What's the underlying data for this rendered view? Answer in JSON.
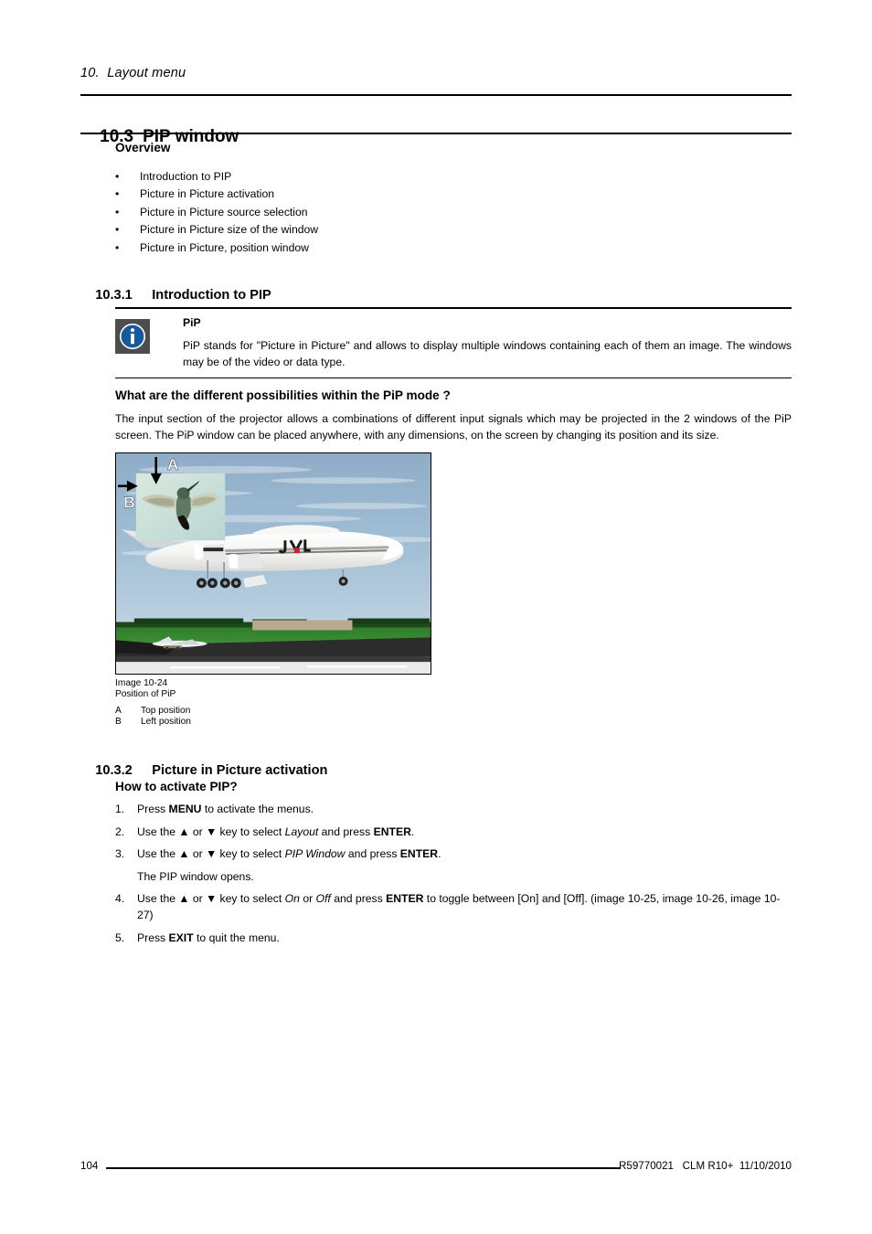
{
  "page": {
    "running_head": "10.  Layout menu",
    "chapter_number": "10.3",
    "chapter_title": "PIP window"
  },
  "overview": {
    "heading": "Overview",
    "bullet_char": "•",
    "items": [
      "Introduction to PIP",
      "Picture in Picture activation",
      "Picture in Picture source selection",
      "Picture in Picture size of the window",
      "Picture in Picture, position window"
    ]
  },
  "section_1": {
    "number": "10.3.1",
    "title": "Introduction to PIP",
    "note": {
      "icon": "info-icon",
      "title": "PiP",
      "text": "PiP stands for \"Picture in Picture\" and allows to display multiple windows containing each of them an image.  The windows may be of the video or data type.",
      "icon_bg_color": "#4d4d4d",
      "icon_circle_color": "#15599e"
    },
    "question_heading": "What are the different possibilities within the PiP mode ?",
    "paragraph": "The input section of the projector allows a combinations of different input signals which may be projected in the 2 windows of the PiP screen.  The PiP window can be placed anywhere, with any dimensions, on the screen by changing its position and its size.",
    "figure": {
      "alt": "Airplane on runway with a Picture-in-Picture window showing a hummingbird",
      "caption_number": "Image 10-24",
      "caption_title": "Position of PiP",
      "label_a": "A",
      "label_b": "B",
      "key": [
        {
          "key": "A",
          "desc": "Top position"
        },
        {
          "key": "B",
          "desc": "Left position"
        }
      ],
      "colors": {
        "sky": "#9cb6cd",
        "grass": "#2e7a2a",
        "runway": "#2d2d2d",
        "fuselage": "#f2f2f2",
        "pip_bg": "#cfe2d8",
        "logo_red": "#cc2222"
      }
    }
  },
  "section_2": {
    "number": "10.3.2",
    "title": "Picture in Picture activation",
    "subheading": "How to activate PIP?",
    "steps": [
      {
        "n": "1.",
        "parts": [
          {
            "t": "Press ",
            "s": "plain"
          },
          {
            "t": "MENU",
            "s": "bold"
          },
          {
            "t": " to activate the menus.",
            "s": "plain"
          }
        ]
      },
      {
        "n": "2.",
        "parts": [
          {
            "t": "Use the ",
            "s": "plain"
          },
          {
            "t": "▲",
            "s": "plain"
          },
          {
            "t": " or ",
            "s": "plain"
          },
          {
            "t": "▼",
            "s": "plain"
          },
          {
            "t": " key to select ",
            "s": "plain"
          },
          {
            "t": "Layout",
            "s": "italic"
          },
          {
            "t": " and press ",
            "s": "plain"
          },
          {
            "t": "ENTER",
            "s": "bold"
          },
          {
            "t": ".",
            "s": "plain"
          }
        ]
      },
      {
        "n": "3.",
        "parts": [
          {
            "t": "Use the ",
            "s": "plain"
          },
          {
            "t": "▲",
            "s": "plain"
          },
          {
            "t": " or ",
            "s": "plain"
          },
          {
            "t": "▼",
            "s": "plain"
          },
          {
            "t": " key to select ",
            "s": "plain"
          },
          {
            "t": "PIP Window",
            "s": "italic"
          },
          {
            "t": " and press ",
            "s": "plain"
          },
          {
            "t": "ENTER",
            "s": "bold"
          },
          {
            "t": ".",
            "s": "plain"
          }
        ]
      },
      {
        "n": "4.",
        "parts": [
          {
            "t": "Use the ",
            "s": "plain"
          },
          {
            "t": "▲",
            "s": "plain"
          },
          {
            "t": " or ",
            "s": "plain"
          },
          {
            "t": "▼",
            "s": "plain"
          },
          {
            "t": " key to select ",
            "s": "plain"
          },
          {
            "t": "On",
            "s": "italic"
          },
          {
            "t": " or ",
            "s": "plain"
          },
          {
            "t": "Off",
            "s": "italic"
          },
          {
            "t": " and press ",
            "s": "plain"
          },
          {
            "t": "ENTER",
            "s": "bold"
          },
          {
            "t": " to toggle between [On] and [Off].  (image 10-25, image 10-26, image 10-27)",
            "s": "plain"
          }
        ]
      },
      {
        "n": "5.",
        "parts": [
          {
            "t": "Press ",
            "s": "plain"
          },
          {
            "t": "EXIT",
            "s": "bold"
          },
          {
            "t": " to quit the menu.",
            "s": "plain"
          }
        ]
      }
    ],
    "result_text": "The PIP window opens."
  },
  "footer": {
    "page_number": "104",
    "document_id": "R59770021   CLM R10+  11/10/2010"
  }
}
